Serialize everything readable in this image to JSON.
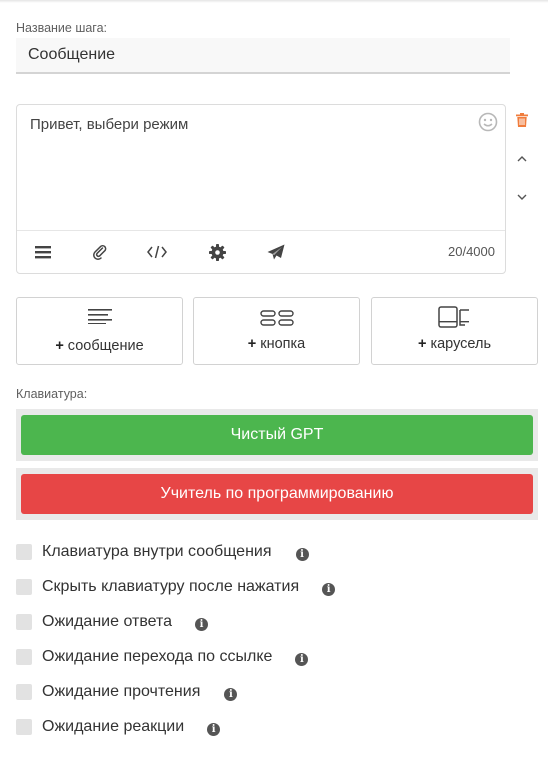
{
  "step": {
    "label": "Название шага:",
    "value": "Сообщение"
  },
  "editor": {
    "text": "Привет, выбери режим",
    "char_count": "20/4000",
    "toolbar": [
      "menu-icon",
      "paperclip-icon",
      "code-icon",
      "gear-icon",
      "send-icon"
    ]
  },
  "add_buttons": {
    "message": {
      "plus": "+",
      "label": "сообщение"
    },
    "button": {
      "plus": "+",
      "label": "кнопка"
    },
    "carousel": {
      "plus": "+",
      "label": "карусель"
    }
  },
  "keyboard": {
    "label": "Клавиатура:",
    "buttons": [
      {
        "label": "Чистый GPT",
        "color": "#4cb64e"
      },
      {
        "label": "Учитель по программированию",
        "color": "#e74646"
      }
    ]
  },
  "options": [
    {
      "label": "Клавиатура внутри сообщения",
      "checked": false
    },
    {
      "label": "Скрыть клавиатуру после нажатия",
      "checked": false
    },
    {
      "label": "Ожидание ответа",
      "checked": false
    },
    {
      "label": "Ожидание перехода по ссылке",
      "checked": false
    },
    {
      "label": "Ожидание прочтения",
      "checked": false
    },
    {
      "label": "Ожидание реакции",
      "checked": false
    }
  ],
  "colors": {
    "delete": "#f07c3c",
    "green": "#4cb64e",
    "red": "#e74646"
  }
}
